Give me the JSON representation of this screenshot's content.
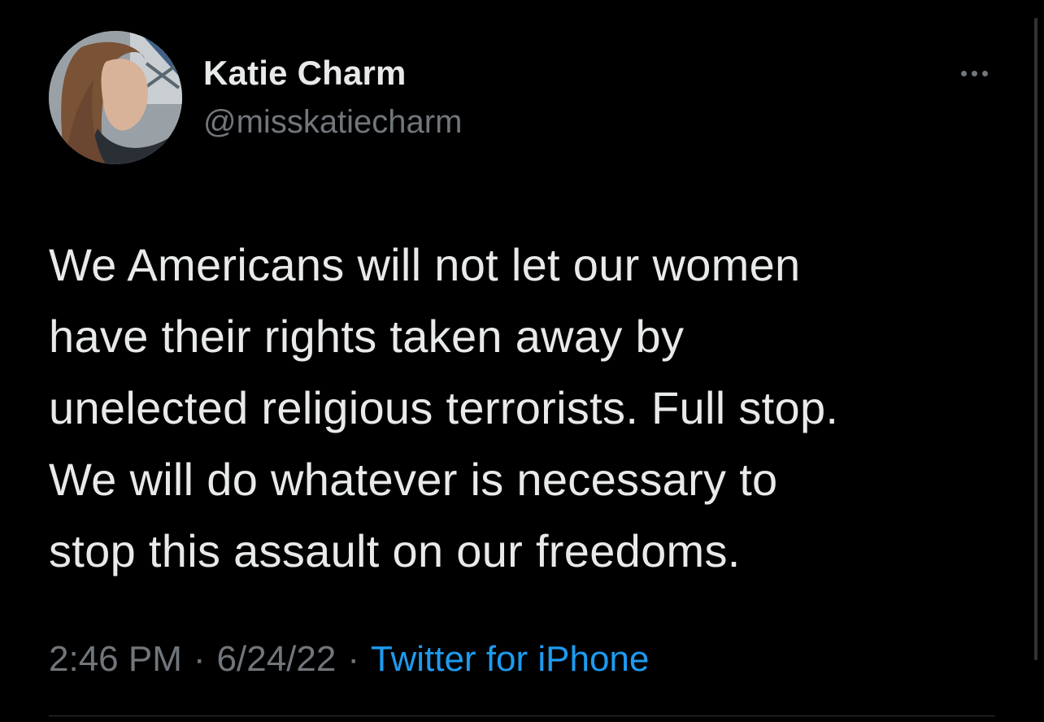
{
  "author": {
    "display_name": "Katie Charm",
    "handle": "@misskatiecharm"
  },
  "tweet": {
    "text_lines": [
      "We Americans will not let our women",
      "have their rights taken away by",
      "unelected religious terrorists. Full stop.",
      "We will do whatever is necessary to",
      "stop this assault on our freedoms."
    ],
    "time": "2:46 PM",
    "separator": "·",
    "date": "6/24/22",
    "source": "Twitter for iPhone"
  },
  "icons": {
    "more": "more-horizontal-icon",
    "avatar": "profile-photo"
  },
  "colors": {
    "background": "#000000",
    "text_primary": "#e7e9ea",
    "text_secondary": "#71767b",
    "link": "#1d9bf0",
    "divider": "#2f3336"
  }
}
